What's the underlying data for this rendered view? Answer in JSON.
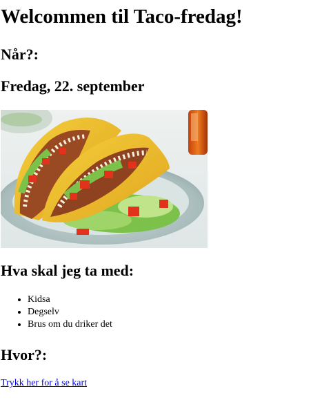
{
  "page": {
    "title": "Welcommen til Taco-fredag!"
  },
  "when": {
    "heading": "Når?:",
    "date": "Fredag, 22. september"
  },
  "image": {
    "subject": "taco-plate-photo"
  },
  "bring": {
    "heading": "Hva skal jeg ta med:",
    "items": [
      "Kidsa",
      "Degselv",
      "Brus om du driker det"
    ]
  },
  "where": {
    "heading": "Hvor?:",
    "link_text": "Trykk her for å se kart"
  },
  "colors": {
    "link": "#0000ee",
    "text": "#000000",
    "background": "#ffffff"
  }
}
